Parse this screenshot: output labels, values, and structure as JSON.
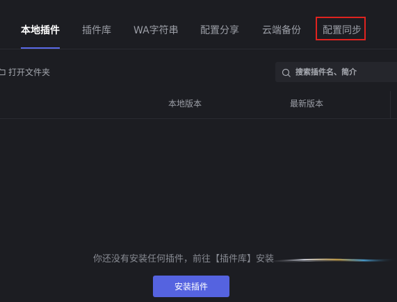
{
  "tabs": [
    {
      "label": "本地插件",
      "active": true
    },
    {
      "label": "插件库",
      "active": false
    },
    {
      "label": "WA字符串",
      "active": false
    },
    {
      "label": "配置分享",
      "active": false
    },
    {
      "label": "云端备份",
      "active": false
    },
    {
      "label": "配置同步",
      "active": false
    }
  ],
  "toolbar": {
    "open_folder_label": "打开文件夹",
    "search_placeholder": "搜索插件名、简介"
  },
  "table": {
    "columns": [
      "本地版本",
      "最新版本"
    ]
  },
  "empty_state": {
    "message": "你还没有安装任何插件，前往【插件库】安装",
    "install_button_label": "安装插件"
  },
  "colors": {
    "background": "#1c1d22",
    "accent": "#5563e0",
    "highlight_box": "#e0231f"
  },
  "icons": {
    "folder": "folder-icon",
    "search": "search-icon"
  }
}
